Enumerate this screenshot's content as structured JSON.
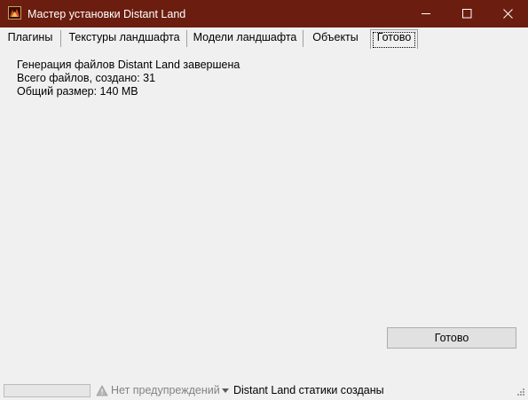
{
  "window": {
    "title": "Мастер установки Distant Land",
    "app_icon": "distant-land-app-icon",
    "title_bar_color": "#6b1e0f",
    "controls": [
      "minimize-icon",
      "maximize-icon",
      "close-icon"
    ]
  },
  "tabs": [
    {
      "label": "Плагины",
      "active": false
    },
    {
      "label": "Текстуры ландшафта",
      "active": false
    },
    {
      "label": "Модели ландшафта",
      "active": false
    },
    {
      "label": "Объекты",
      "active": false
    },
    {
      "label": "Готово",
      "active": true
    }
  ],
  "main": {
    "lines": [
      "Генерация файлов Distant Land завершена",
      "Всего файлов, создано: 31",
      "Общий размер: 140 MB"
    ],
    "done_button_label": "Готово"
  },
  "statusbar": {
    "progress": 0,
    "warnings_icon": "warning-icon",
    "warnings_text": "Нет предупреждений",
    "dropdown_icon": "dropdown-arrow-icon",
    "status_text": "Distant Land статики созданы"
  }
}
